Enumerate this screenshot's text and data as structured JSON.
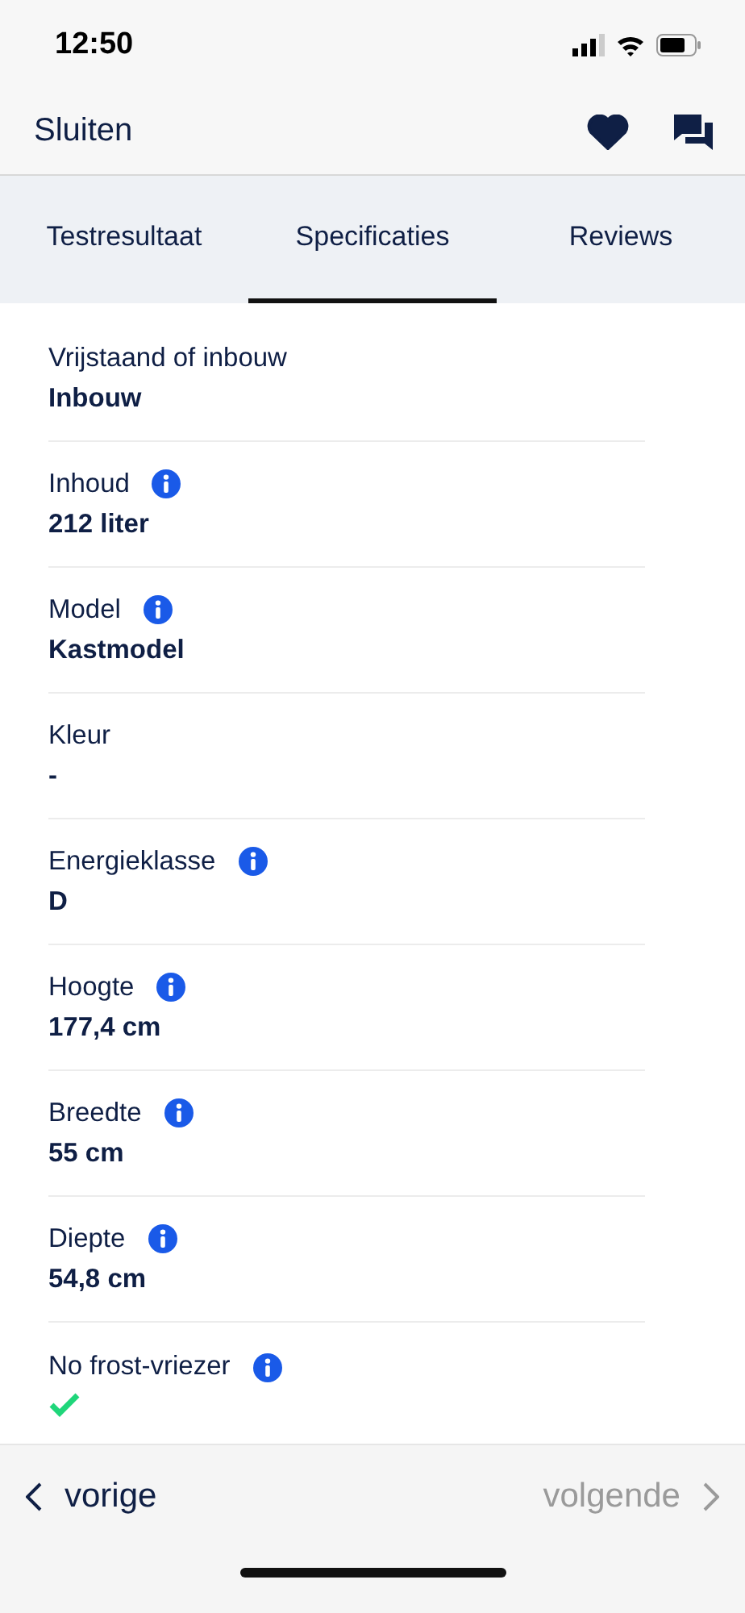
{
  "status_bar": {
    "time": "12:50"
  },
  "header": {
    "close_label": "Sluiten",
    "favorite": true
  },
  "tabs": [
    {
      "label": "Testresultaat",
      "selected": false
    },
    {
      "label": "Specificaties",
      "selected": true
    },
    {
      "label": "Reviews",
      "selected": false
    }
  ],
  "specs": [
    {
      "label": "Vrijstaand of inbouw",
      "info": false,
      "kind": "text",
      "value": "Inbouw"
    },
    {
      "label": "Inhoud",
      "info": true,
      "kind": "text",
      "value": "212 liter"
    },
    {
      "label": "Model",
      "info": true,
      "kind": "text",
      "value": "Kastmodel"
    },
    {
      "label": "Kleur",
      "info": false,
      "kind": "text",
      "value": "-"
    },
    {
      "label": "Energieklasse",
      "info": true,
      "kind": "text",
      "value": "D"
    },
    {
      "label": "Hoogte",
      "info": true,
      "kind": "text",
      "value": "177,4 cm"
    },
    {
      "label": "Breedte",
      "info": true,
      "kind": "text",
      "value": "55 cm"
    },
    {
      "label": "Diepte",
      "info": true,
      "kind": "text",
      "value": "54,8 cm"
    },
    {
      "label": "No frost-vriezer",
      "info": true,
      "kind": "check",
      "checked": true
    }
  ],
  "nav": {
    "previous": {
      "label": "vorige",
      "disabled": false
    },
    "next": {
      "label": "volgende",
      "disabled": true
    }
  }
}
